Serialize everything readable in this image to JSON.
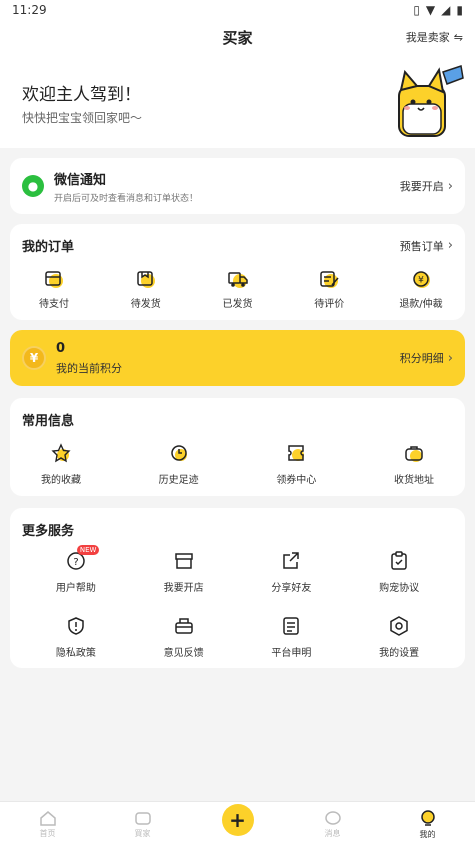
{
  "status": {
    "time": "11:29"
  },
  "header": {
    "title": "买家",
    "switch_label": "我是卖家"
  },
  "hero": {
    "greeting": "欢迎主人驾到！",
    "subtitle": "快快把宝宝领回家吧～"
  },
  "wechat": {
    "title": "微信通知",
    "desc": "开启后可及时查看消息和订单状态！",
    "action": "我要开启"
  },
  "orders": {
    "title": "我的订单",
    "link": "预售订单",
    "items": [
      {
        "label": "待支付",
        "icon": "wallet-icon"
      },
      {
        "label": "待发货",
        "icon": "box-icon"
      },
      {
        "label": "已发货",
        "icon": "truck-icon"
      },
      {
        "label": "待评价",
        "icon": "review-icon"
      },
      {
        "label": "退款/仲裁",
        "icon": "refund-icon"
      }
    ]
  },
  "points": {
    "value": "0",
    "label": "我的当前积分",
    "link": "积分明细"
  },
  "common": {
    "title": "常用信息",
    "items": [
      {
        "label": "我的收藏",
        "icon": "star-icon"
      },
      {
        "label": "历史足迹",
        "icon": "clock-icon"
      },
      {
        "label": "领券中心",
        "icon": "coupon-icon"
      },
      {
        "label": "收货地址",
        "icon": "address-icon"
      }
    ]
  },
  "more": {
    "title": "更多服务",
    "new_badge": "NEW",
    "items": [
      {
        "label": "用户帮助",
        "icon": "help-icon"
      },
      {
        "label": "我要开店",
        "icon": "shop-icon"
      },
      {
        "label": "分享好友",
        "icon": "share-icon"
      },
      {
        "label": "购宠协议",
        "icon": "clipboard-icon"
      },
      {
        "label": "隐私政策",
        "icon": "shield-icon"
      },
      {
        "label": "意见反馈",
        "icon": "feedback-icon"
      },
      {
        "label": "平台申明",
        "icon": "document-icon"
      },
      {
        "label": "我的设置",
        "icon": "settings-icon"
      }
    ]
  },
  "tabbar": {
    "items": [
      {
        "label": "首页"
      },
      {
        "label": "買家"
      },
      {
        "label": "+"
      },
      {
        "label": "消息"
      },
      {
        "label": "我的"
      }
    ]
  },
  "colors": {
    "accent": "#fcd12a",
    "wechat": "#2bbf3f",
    "badge": "#f24040"
  }
}
